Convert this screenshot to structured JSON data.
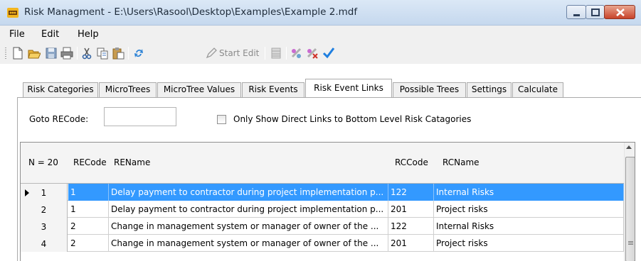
{
  "window": {
    "title": "Risk Managment - E:\\Users\\Rasool\\Desktop\\Examples\\Example 2.mdf",
    "icon": "app-icon"
  },
  "menu": {
    "file": "File",
    "edit": "Edit",
    "help": "Help"
  },
  "toolbar": {
    "icons": [
      "new-icon",
      "open-icon",
      "save-icon",
      "print-icon",
      "cut-icon",
      "copy-icon",
      "paste-icon",
      "refresh-icon",
      "pencil-icon",
      "grid-icon",
      "add-link-icon",
      "remove-link-icon",
      "check-icon"
    ],
    "start_edit": "Start Edit"
  },
  "tabs": [
    {
      "label": "Risk Categories",
      "active": false
    },
    {
      "label": "MicroTrees",
      "active": false
    },
    {
      "label": "MicroTree Values",
      "active": false
    },
    {
      "label": "Risk Events",
      "active": false
    },
    {
      "label": "Risk Event Links",
      "active": true
    },
    {
      "label": "Possible Trees",
      "active": false
    },
    {
      "label": "Settings",
      "active": false
    },
    {
      "label": "Calculate",
      "active": false
    }
  ],
  "filter": {
    "goto_label": "Goto RECode:",
    "goto_value": "",
    "checkbox_label": "Only Show Direct Links to Bottom Level Risk Catagories",
    "checkbox_checked": false
  },
  "grid": {
    "columns": {
      "count": "N = 20",
      "recode": "RECode",
      "rename": "REName",
      "rccode": "RCCode",
      "rcname": "RCName"
    },
    "rows": [
      {
        "n": "1",
        "recode": "1",
        "rename": "Delay payment to contractor during project implementation p...",
        "rccode": "122",
        "rcname": "Internal Risks",
        "selected": true
      },
      {
        "n": "2",
        "recode": "1",
        "rename": "Delay payment to contractor during project implementation p...",
        "rccode": "201",
        "rcname": "Project risks",
        "selected": false
      },
      {
        "n": "3",
        "recode": "2",
        "rename": "Change in management system or manager of owner of the ...",
        "rccode": "122",
        "rcname": "Internal Risks",
        "selected": false
      },
      {
        "n": "4",
        "recode": "2",
        "rename": "Change in management system or manager of owner of the ...",
        "rccode": "201",
        "rcname": "Project risks",
        "selected": false
      }
    ]
  },
  "colors": {
    "selection": "#3399ff",
    "titlebar": "#c5d8ee",
    "close_button": "#c8432a"
  }
}
